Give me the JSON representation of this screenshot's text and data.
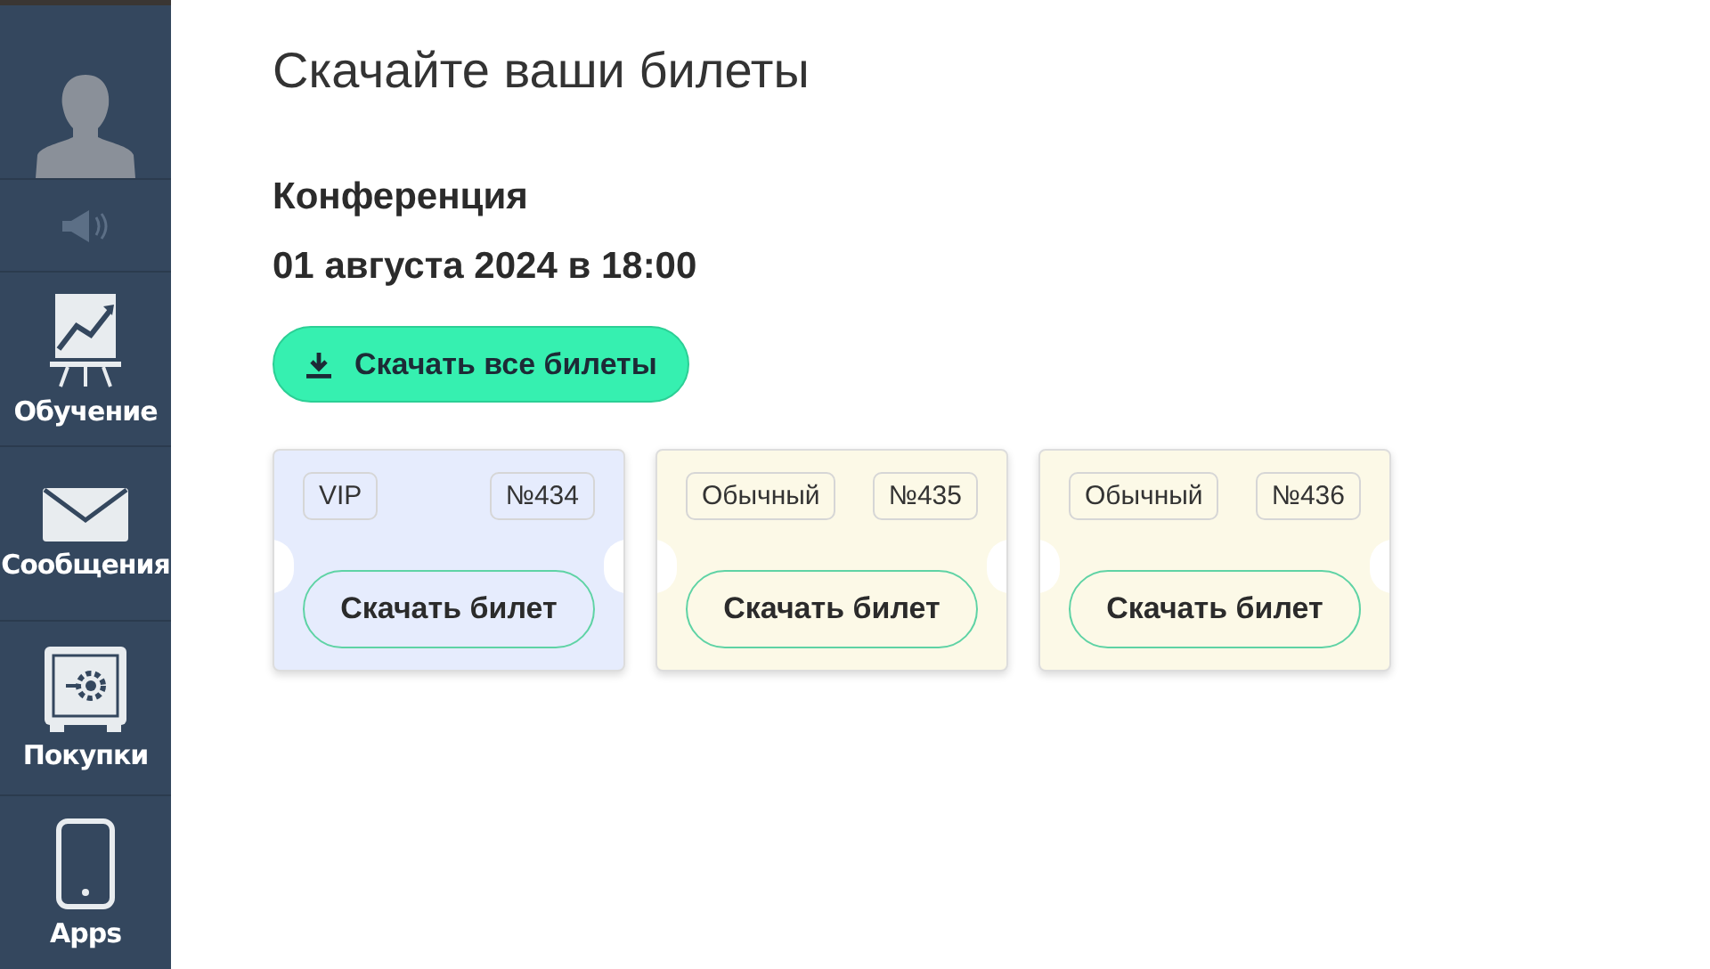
{
  "sidebar": {
    "items": [
      {
        "kind": "avatar"
      },
      {
        "kind": "speaker"
      },
      {
        "kind": "chart",
        "label": "Обучение"
      },
      {
        "kind": "mail",
        "label": "Сообщения"
      },
      {
        "kind": "safe",
        "label": "Покупки"
      },
      {
        "kind": "phone",
        "label": "Apps"
      }
    ]
  },
  "page": {
    "title": "Скачайте ваши билеты",
    "event": "Конференция",
    "date": "01 августа 2024 в 18:00",
    "download_all": "Скачать все билеты"
  },
  "tickets": [
    {
      "kind": "vip",
      "type": "VIP",
      "number": "№434",
      "button": "Скачать билет"
    },
    {
      "kind": "regular",
      "type": "Обычный",
      "number": "№435",
      "button": "Скачать билет"
    },
    {
      "kind": "regular",
      "type": "Обычный",
      "number": "№436",
      "button": "Скачать билет"
    }
  ]
}
